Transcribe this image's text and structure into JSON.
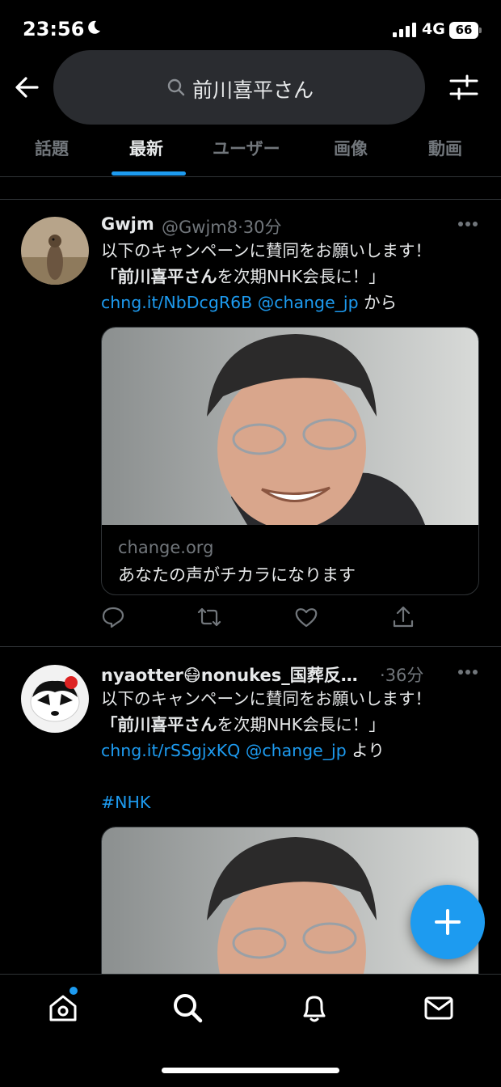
{
  "status": {
    "time": "23:56",
    "network": "4G",
    "battery": "66"
  },
  "search": {
    "query": "前川喜平さん"
  },
  "tabs": [
    "話題",
    "最新",
    "ユーザー",
    "画像",
    "動画"
  ],
  "tweets": [
    {
      "name": "Gwjm",
      "handle": "@Gwjm8",
      "time": "30分",
      "line1": "以下のキャンペーンに賛同をお願いします！",
      "line2_bold": "「前川喜平さん",
      "line2_rest": "を次期NHK会長に！」",
      "link1": "chng.it/NbDcgR6B",
      "link2": "@change_jp",
      "suffix": "から",
      "card_domain": "change.org",
      "card_title": "あなたの声がチカラになります"
    },
    {
      "name": "nyaotter😷nonukes_国葬反…",
      "time": "36分",
      "line1": "以下のキャンペーンに賛同をお願いします！",
      "line2_bold": "「前川喜平さん",
      "line2_rest": "を次期NHK会長に！」",
      "link1": "chng.it/rSSgjxKQ",
      "link2": "@change_jp",
      "suffix": "より",
      "hashtag": "#NHK"
    }
  ],
  "icons": {
    "back": "arrow-left-icon",
    "search": "search-icon",
    "filter": "sliders-icon",
    "reply": "reply-icon",
    "retweet": "retweet-icon",
    "like": "heart-icon",
    "share": "share-icon",
    "compose": "plus-icon",
    "nav": [
      "home-icon",
      "search-icon",
      "bell-icon",
      "mail-icon"
    ]
  },
  "colors": {
    "accent": "#1d9bf0",
    "background": "#000000",
    "muted": "#71767b"
  }
}
